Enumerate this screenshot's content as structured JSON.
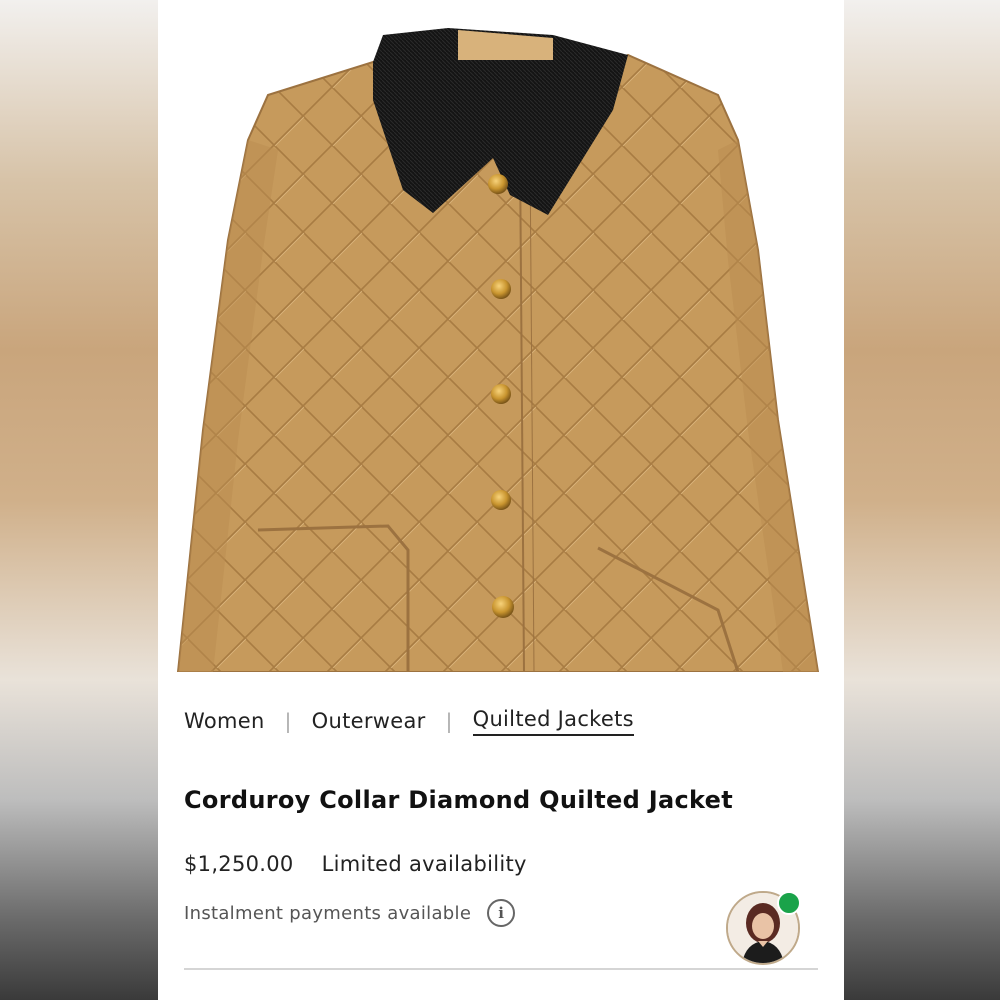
{
  "breadcrumb": {
    "items": [
      "Women",
      "Outerwear",
      "Quilted Jackets"
    ],
    "separator": "|",
    "active_index": 2
  },
  "product": {
    "title": "Corduroy Collar Diamond Quilted Jacket",
    "price": "$1,250.00",
    "availability": "Limited availability",
    "instalment_text": "Instalment payments available",
    "info_icon_glyph": "i"
  },
  "chat_agent": {
    "status": "online"
  },
  "colors": {
    "jacket": "#c69a5c",
    "collar": "#141414",
    "button": "#c9952f",
    "online": "#1aa34a"
  },
  "icons": {
    "info": "info-icon",
    "avatar": "support-agent-avatar"
  }
}
